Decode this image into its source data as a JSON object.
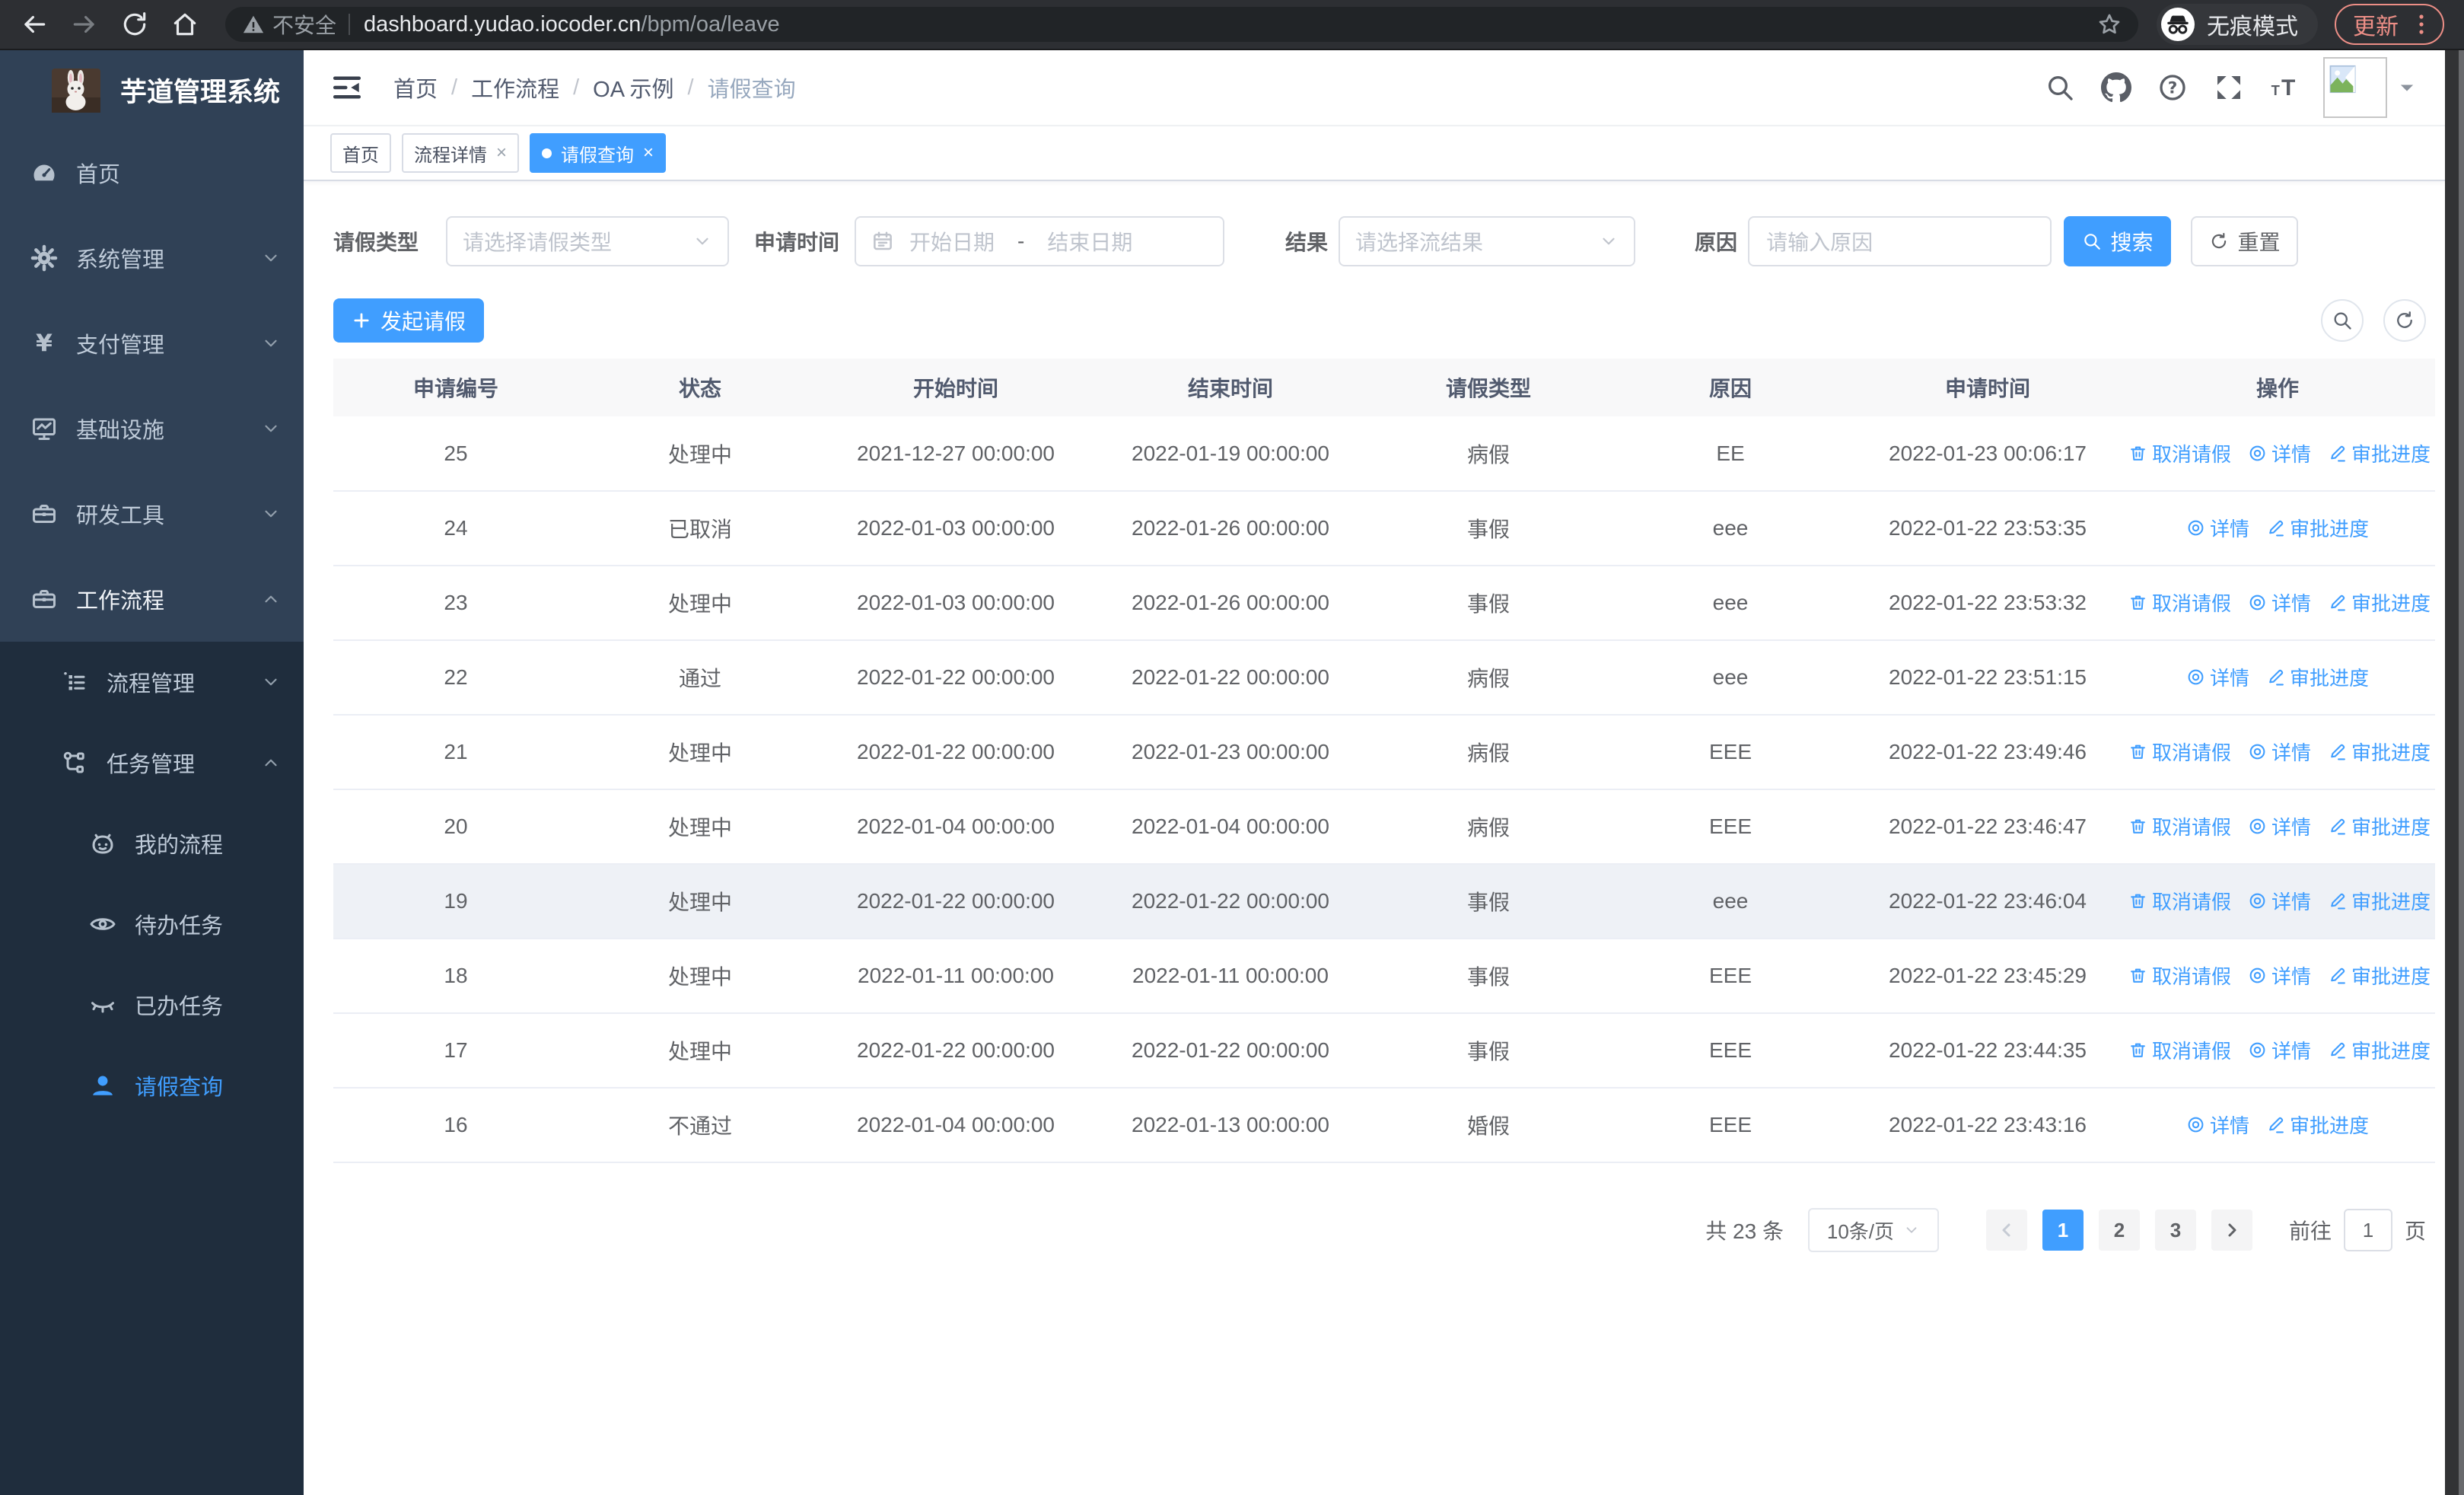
{
  "browser": {
    "insecure_label": "不安全",
    "url_host": "dashboard.yudao.iocoder.cn",
    "url_path": "/bpm/oa/leave",
    "incognito_label": "无痕模式",
    "update_label": "更新"
  },
  "sidebar": {
    "title": "芋道管理系统",
    "items": [
      {
        "label": "首页",
        "icon": "dashboard-icon",
        "level": 1,
        "chevron": ""
      },
      {
        "label": "系统管理",
        "icon": "gear-icon",
        "level": 1,
        "chevron": "down"
      },
      {
        "label": "支付管理",
        "icon": "yen-icon",
        "level": 1,
        "chevron": "down"
      },
      {
        "label": "基础设施",
        "icon": "monitor-icon",
        "level": 1,
        "chevron": "down"
      },
      {
        "label": "研发工具",
        "icon": "toolbox-icon",
        "level": 1,
        "chevron": "down"
      },
      {
        "label": "工作流程",
        "icon": "toolbox-icon",
        "level": 1,
        "chevron": "up",
        "highlight": true
      },
      {
        "label": "流程管理",
        "icon": "list-icon",
        "level": 2,
        "chevron": "down",
        "dark": true
      },
      {
        "label": "任务管理",
        "icon": "flow-icon",
        "level": 2,
        "chevron": "up",
        "dark": true
      },
      {
        "label": "我的流程",
        "icon": "robot-icon",
        "level": 3,
        "dark": true
      },
      {
        "label": "待办任务",
        "icon": "eye-open-icon",
        "level": 3,
        "dark": true
      },
      {
        "label": "已办任务",
        "icon": "eye-closed-icon",
        "level": 3,
        "dark": true
      },
      {
        "label": "请假查询",
        "icon": "user-icon",
        "level": 3,
        "dark": true,
        "active": true
      }
    ]
  },
  "header": {
    "breadcrumb": [
      "首页",
      "工作流程",
      "OA 示例",
      "请假查询"
    ],
    "breadcrumb_separator": "/"
  },
  "tabs": [
    {
      "label": "首页",
      "closable": false,
      "active": false
    },
    {
      "label": "流程详情",
      "closable": true,
      "active": false
    },
    {
      "label": "请假查询",
      "closable": true,
      "active": true
    }
  ],
  "tabs_meta": {
    "close_glyph": "×"
  },
  "filters": {
    "leave_type_label": "请假类型",
    "leave_type_placeholder": "请选择请假类型",
    "apply_time_label": "申请时间",
    "start_placeholder": "开始日期",
    "range_separator": "-",
    "end_placeholder": "结束日期",
    "result_label": "结果",
    "result_placeholder": "请选择流结果",
    "reason_label": "原因",
    "reason_placeholder": "请输入原因",
    "search_label": "搜索",
    "reset_label": "重置"
  },
  "toolbar": {
    "create_label": "发起请假"
  },
  "table": {
    "columns": [
      "申请编号",
      "状态",
      "开始时间",
      "结束时间",
      "请假类型",
      "原因",
      "申请时间",
      "操作"
    ],
    "action_labels": {
      "cancel": "取消请假",
      "detail": "详情",
      "progress": "审批进度"
    },
    "rows": [
      {
        "id": "25",
        "status": "处理中",
        "start": "2021-12-27 00:00:00",
        "end": "2022-01-19 00:00:00",
        "type": "病假",
        "reason": "EE",
        "apply_time": "2022-01-23 00:06:17",
        "cancelable": true
      },
      {
        "id": "24",
        "status": "已取消",
        "start": "2022-01-03 00:00:00",
        "end": "2022-01-26 00:00:00",
        "type": "事假",
        "reason": "eee",
        "apply_time": "2022-01-22 23:53:35",
        "cancelable": false
      },
      {
        "id": "23",
        "status": "处理中",
        "start": "2022-01-03 00:00:00",
        "end": "2022-01-26 00:00:00",
        "type": "事假",
        "reason": "eee",
        "apply_time": "2022-01-22 23:53:32",
        "cancelable": true
      },
      {
        "id": "22",
        "status": "通过",
        "start": "2022-01-22 00:00:00",
        "end": "2022-01-22 00:00:00",
        "type": "病假",
        "reason": "eee",
        "apply_time": "2022-01-22 23:51:15",
        "cancelable": false
      },
      {
        "id": "21",
        "status": "处理中",
        "start": "2022-01-22 00:00:00",
        "end": "2022-01-23 00:00:00",
        "type": "病假",
        "reason": "EEE",
        "apply_time": "2022-01-22 23:49:46",
        "cancelable": true
      },
      {
        "id": "20",
        "status": "处理中",
        "start": "2022-01-04 00:00:00",
        "end": "2022-01-04 00:00:00",
        "type": "病假",
        "reason": "EEE",
        "apply_time": "2022-01-22 23:46:47",
        "cancelable": true
      },
      {
        "id": "19",
        "status": "处理中",
        "start": "2022-01-22 00:00:00",
        "end": "2022-01-22 00:00:00",
        "type": "事假",
        "reason": "eee",
        "apply_time": "2022-01-22 23:46:04",
        "cancelable": true,
        "highlighted": true
      },
      {
        "id": "18",
        "status": "处理中",
        "start": "2022-01-11 00:00:00",
        "end": "2022-01-11 00:00:00",
        "type": "事假",
        "reason": "EEE",
        "apply_time": "2022-01-22 23:45:29",
        "cancelable": true
      },
      {
        "id": "17",
        "status": "处理中",
        "start": "2022-01-22 00:00:00",
        "end": "2022-01-22 00:00:00",
        "type": "事假",
        "reason": "EEE",
        "apply_time": "2022-01-22 23:44:35",
        "cancelable": true
      },
      {
        "id": "16",
        "status": "不通过",
        "start": "2022-01-04 00:00:00",
        "end": "2022-01-13 00:00:00",
        "type": "婚假",
        "reason": "EEE",
        "apply_time": "2022-01-22 23:43:16",
        "cancelable": false
      }
    ]
  },
  "pagination": {
    "total_label": "共 23 条",
    "page_size_label": "10条/页",
    "pages": [
      "1",
      "2",
      "3"
    ],
    "active_page": "1",
    "goto_label": "前往",
    "goto_value": "1",
    "page_unit": "页"
  },
  "colors": {
    "accent": "#409eff",
    "sidebar_bg": "#304156",
    "submenu_bg": "#1f2d3d",
    "link": "#409eff",
    "update_badge": "#ec8e86",
    "table_header_bg": "#f8f8f9",
    "highlight_row": "#eef1f6"
  },
  "icons": [
    "back-icon",
    "forward-icon",
    "reload-icon",
    "home-icon",
    "warning-icon",
    "bookmark-star-icon",
    "incognito-icon",
    "kebab-menu-icon",
    "collapse-sidebar-icon",
    "dashboard-icon",
    "gear-icon",
    "yen-icon",
    "monitor-icon",
    "toolbox-icon",
    "list-icon",
    "flow-icon",
    "robot-icon",
    "eye-open-icon",
    "eye-closed-icon",
    "user-icon",
    "search-icon",
    "github-icon",
    "help-icon",
    "fullscreen-icon",
    "font-size-icon",
    "caret-down-icon",
    "calendar-icon",
    "refresh-icon",
    "plus-icon",
    "delete-icon",
    "view-icon",
    "edit-icon",
    "chevron-down-icon",
    "chevron-up-icon",
    "chevron-left-icon",
    "chevron-right-icon",
    "broken-image-icon",
    "rabbit-logo"
  ]
}
